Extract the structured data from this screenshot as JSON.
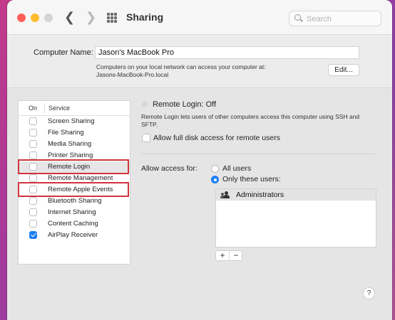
{
  "window": {
    "title": "Sharing"
  },
  "search": {
    "placeholder": "Search"
  },
  "computer_name": {
    "label": "Computer Name:",
    "value": "Jason's MacBook Pro",
    "description_line1": "Computers on your local network can access your computer at:",
    "description_line2": "Jasons-MacBook-Pro.local",
    "edit_label": "Edit..."
  },
  "services": {
    "header_on": "On",
    "header_service": "Service",
    "items": [
      {
        "label": "Screen Sharing",
        "checked": false
      },
      {
        "label": "File Sharing",
        "checked": false
      },
      {
        "label": "Media Sharing",
        "checked": false
      },
      {
        "label": "Printer Sharing",
        "checked": false
      },
      {
        "label": "Remote Login",
        "checked": false,
        "selected": true
      },
      {
        "label": "Remote Management",
        "checked": false
      },
      {
        "label": "Remote Apple Events",
        "checked": false
      },
      {
        "label": "Bluetooth Sharing",
        "checked": false
      },
      {
        "label": "Internet Sharing",
        "checked": false
      },
      {
        "label": "Content Caching",
        "checked": false
      },
      {
        "label": "AirPlay Receiver",
        "checked": true
      }
    ]
  },
  "detail": {
    "status": "Remote Login: Off",
    "description": "Remote Login lets users of other computers access this computer using SSH and SFTP.",
    "full_disk_label": "Allow full disk access for remote users",
    "access_label": "Allow access for:",
    "radio_all": "All users",
    "radio_only": "Only these users:",
    "selected_access": "Only these users:",
    "users": [
      "Administrators"
    ],
    "add_label": "+",
    "remove_label": "−",
    "help_label": "?"
  },
  "colors": {
    "accent": "#1a7ef5",
    "highlight_border": "#d0343d",
    "close": "#ff5f57",
    "minimize": "#febc2e"
  }
}
